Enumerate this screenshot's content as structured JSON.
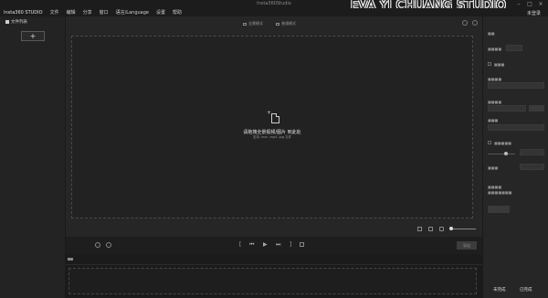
{
  "window": {
    "title": "Insta360Studio",
    "controls": [
      "–",
      "□",
      "×"
    ]
  },
  "watermark": "EVA YJ CHUANG STUDIO",
  "menubar": {
    "brand": "Insta360 STUDIO",
    "items": [
      "文件",
      "编辑",
      "分享",
      "窗口",
      "语言/Language",
      "设置",
      "帮助"
    ],
    "login": "未登录"
  },
  "file_list": {
    "title": "文件列表",
    "add_label": "+"
  },
  "view_modes": {
    "panorama": "全景模式",
    "normal": "普通模式"
  },
  "dropzone": {
    "plus": "+",
    "title": "请拖拽全景视频/图片 到此处",
    "formats": "支持 .insv .mp4 .jpg 文件"
  },
  "playback": {
    "controls": [
      "[",
      "⏮",
      "▶",
      "⏭",
      "]"
    ],
    "export_label": "导出"
  },
  "footer": {
    "left": "未完成",
    "right": "已完成"
  },
  "colors": {
    "background": "#262626",
    "panel": "#232323",
    "bar": "#1c1c1c"
  }
}
